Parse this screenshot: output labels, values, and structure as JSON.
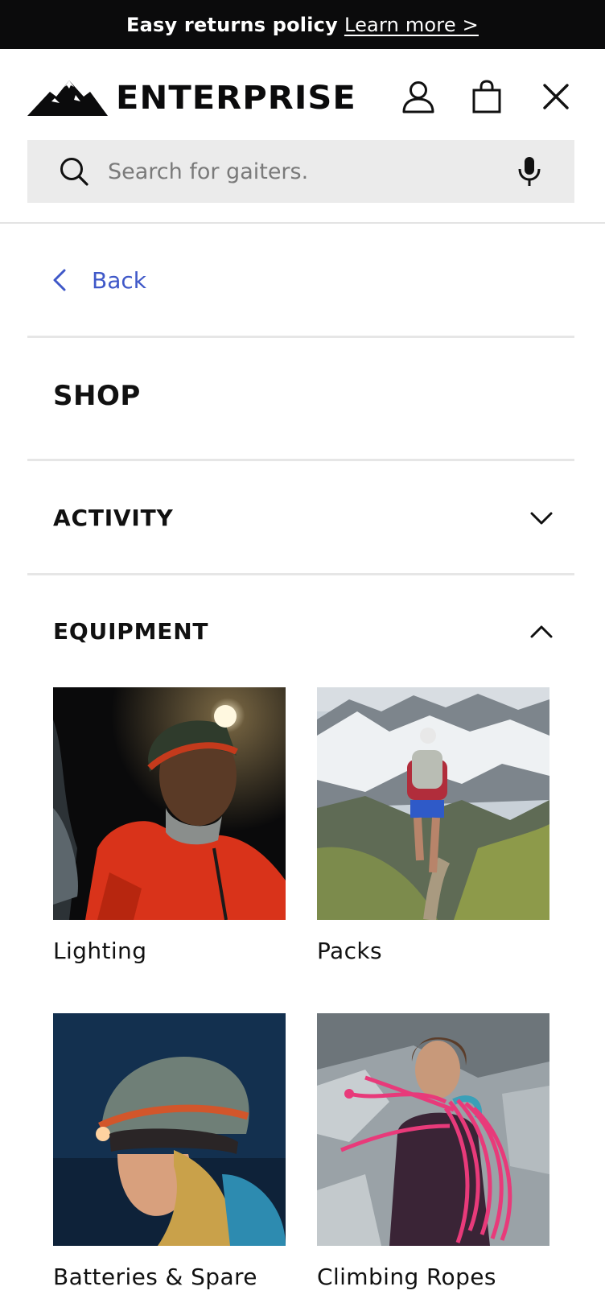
{
  "announcement": {
    "text": "Easy returns policy",
    "link": "Learn more >"
  },
  "header": {
    "brand": "ENTERPRISE",
    "icons": [
      "account-icon",
      "shopping-bag-icon",
      "close-icon"
    ],
    "search": {
      "placeholder": "Search for gaiters.",
      "value": ""
    }
  },
  "menu": {
    "back_label": "Back",
    "heading": "SHOP",
    "accordions": [
      {
        "label": "ACTIVITY",
        "expanded": false
      },
      {
        "label": "EQUIPMENT",
        "expanded": true
      }
    ],
    "equipment_tiles": [
      {
        "label": "Lighting",
        "image": "man-with-headlamp-photo"
      },
      {
        "label": "Packs",
        "image": "trail-runner-mountains-photo"
      },
      {
        "label": "Batteries & Spare",
        "image": "climber-helmet-headlamp-photo"
      },
      {
        "label": "Climbing Ropes",
        "image": "woman-carrying-rope-photo"
      }
    ]
  },
  "colors": {
    "announcement_bg": "#0b0b0c",
    "search_bg": "#ebebeb",
    "link_blue": "#3f58c8",
    "divider": "#e6e6e6"
  }
}
